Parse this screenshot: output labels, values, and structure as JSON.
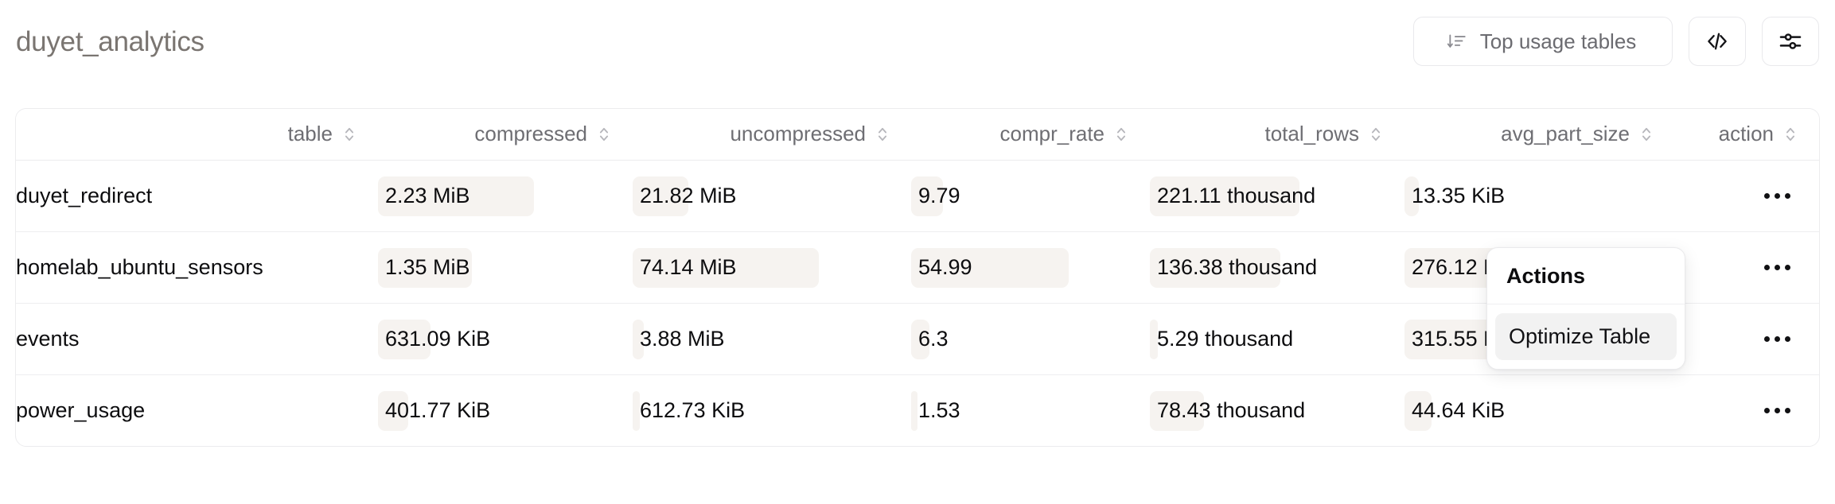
{
  "header": {
    "title": "duyet_analytics",
    "buttons": {
      "top_usage": {
        "label": "Top usage tables",
        "icon": "sort-descending-icon"
      },
      "code": {
        "label": "",
        "icon": "code-icon"
      },
      "settings": {
        "label": "",
        "icon": "sliders-icon"
      }
    }
  },
  "table": {
    "columns": [
      {
        "key": "table",
        "label": "table",
        "sortable": true
      },
      {
        "key": "compressed",
        "label": "compressed",
        "sortable": true
      },
      {
        "key": "uncompressed",
        "label": "uncompressed",
        "sortable": true
      },
      {
        "key": "compr_rate",
        "label": "compr_rate",
        "sortable": true
      },
      {
        "key": "total_rows",
        "label": "total_rows",
        "sortable": true
      },
      {
        "key": "avg_part_size",
        "label": "avg_part_size",
        "sortable": true
      },
      {
        "key": "action",
        "label": "action",
        "sortable": true
      }
    ],
    "rows": [
      {
        "table": "duyet_redirect",
        "compressed": "2.23 MiB",
        "uncompressed": "21.82 MiB",
        "compr_rate": "9.79",
        "total_rows": "221.11 thousand",
        "avg_part_size": "13.35 KiB",
        "action": "…"
      },
      {
        "table": "homelab_ubuntu_sensors",
        "compressed": "1.35 MiB",
        "uncompressed": "74.14 MiB",
        "compr_rate": "54.99",
        "total_rows": "136.38 thousand",
        "avg_part_size": "276.12 KiB",
        "action": "…"
      },
      {
        "table": "events",
        "compressed": "631.09 KiB",
        "uncompressed": "3.88 MiB",
        "compr_rate": "6.3",
        "total_rows": "5.29 thousand",
        "avg_part_size": "315.55 KiB",
        "action": "…"
      },
      {
        "table": "power_usage",
        "compressed": "401.77 KiB",
        "uncompressed": "612.73 KiB",
        "compr_rate": "1.53",
        "total_rows": "78.43 thousand",
        "avg_part_size": "44.64 KiB",
        "action": "…"
      }
    ],
    "bar_widths": [
      {
        "compressed": 196,
        "uncompressed": 70,
        "compr_rate": 40,
        "total_rows": 188,
        "avg_part_size": 18
      },
      {
        "compressed": 118,
        "uncompressed": 234,
        "compr_rate": 198,
        "total_rows": 164,
        "avg_part_size": 213
      },
      {
        "compressed": 66,
        "uncompressed": 14,
        "compr_rate": 23,
        "total_rows": 10,
        "avg_part_size": 211
      },
      {
        "compressed": 38,
        "uncompressed": 9,
        "compr_rate": 8,
        "total_rows": 68,
        "avg_part_size": 34
      }
    ]
  },
  "actions_popup": {
    "title": "Actions",
    "items": [
      {
        "label": "Optimize Table",
        "active": true
      }
    ]
  },
  "colors": {
    "bar": "#f6f3f0",
    "title": "#7a7571",
    "border": "#ececee",
    "text": "#0d0d0f",
    "header_text": "#6e6e73",
    "popup_hover": "#f2f2f2"
  }
}
